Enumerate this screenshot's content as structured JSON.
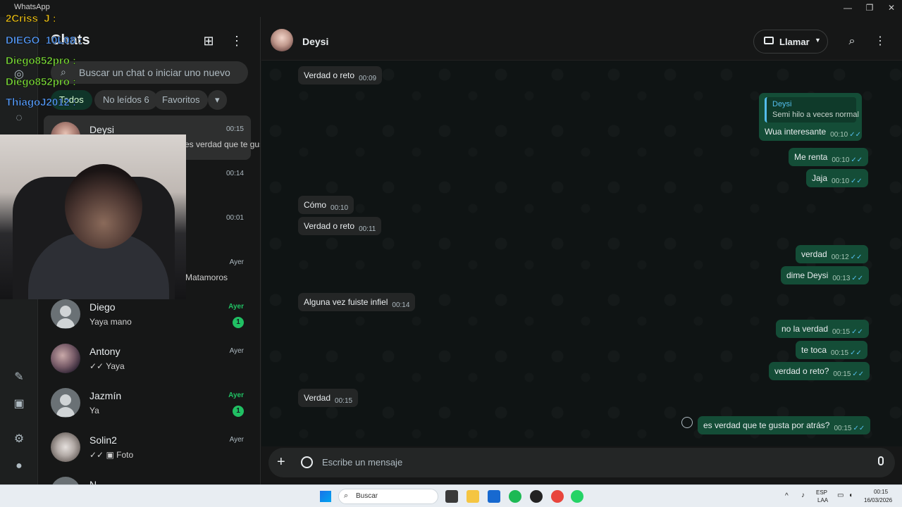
{
  "window": {
    "app_label": "WhatsApp",
    "controls": [
      "—",
      "❐",
      "✕"
    ]
  },
  "sidebar": {
    "title": "Chats",
    "search_placeholder": "Buscar un chat o iniciar uno nuevo",
    "filters": [
      {
        "label": "Todos",
        "active": true
      },
      {
        "label": "No leídos 6",
        "active": false
      },
      {
        "label": "Favoritos",
        "active": false
      }
    ],
    "chats": [
      {
        "name": "Deysi",
        "preview": "es verdad que te gusta por atrás?",
        "time": "00:15",
        "selected": true
      },
      {
        "name": "",
        "preview": "",
        "time": "00:14"
      },
      {
        "name": "",
        "preview": "",
        "time": "00:01"
      },
      {
        "name": "",
        "preview": "Matamoros",
        "time": "Ayer"
      },
      {
        "name": "Diego",
        "preview": "Yaya mano",
        "time": "Ayer",
        "unread": "1"
      },
      {
        "name": "Antony",
        "preview": "✓✓ Yaya",
        "time": "Ayer"
      },
      {
        "name": "Jazmín",
        "preview": "Ya",
        "time": "Ayer",
        "unread": "1"
      },
      {
        "name": "Solin2",
        "preview": "✓✓ ▣ Foto",
        "time": "Ayer"
      },
      {
        "name": "N",
        "preview": "",
        "time": ""
      }
    ]
  },
  "conversation": {
    "contact_name": "Deysi",
    "call_label": "Llamar",
    "composer_placeholder": "Escribe un mensaje",
    "messages": [
      {
        "dir": "in",
        "text": "Verdad o reto",
        "time": "00:09"
      },
      {
        "dir": "out",
        "quote_name": "Deysi",
        "quote_text": "Semi hilo a veces normal",
        "text": "Wua interesante",
        "time": "00:10"
      },
      {
        "dir": "out",
        "text": "Me renta",
        "time": "00:10"
      },
      {
        "dir": "out",
        "text": "Jaja",
        "time": "00:10"
      },
      {
        "dir": "in",
        "text": "Cómo",
        "time": "00:10"
      },
      {
        "dir": "in",
        "text": "Verdad o reto",
        "time": "00:11"
      },
      {
        "dir": "out",
        "text": "verdad",
        "time": "00:12"
      },
      {
        "dir": "out",
        "text": "dime Deysi",
        "time": "00:13"
      },
      {
        "dir": "in",
        "text": "Alguna vez fuiste infiel",
        "time": "00:14"
      },
      {
        "dir": "out",
        "text": "no la verdad",
        "time": "00:15"
      },
      {
        "dir": "out",
        "text": "te toca",
        "time": "00:15"
      },
      {
        "dir": "out",
        "text": "verdad o reto?",
        "time": "00:15"
      },
      {
        "dir": "in",
        "text": "Verdad",
        "time": "00:15"
      },
      {
        "dir": "out",
        "text": "es verdad que te gusta por atrás?",
        "time": "00:15"
      }
    ]
  },
  "stream_chat_overlay": [
    {
      "user": "2Criss_J :",
      "color": "#f0c419"
    },
    {
      "user": "DIEGO_10L08 :",
      "color": "#5aa0ff"
    },
    {
      "user": "Diego852pro :",
      "color": "#7ddc3a"
    },
    {
      "user": "Diego852pro :",
      "color": "#7ddc3a"
    },
    {
      "user": "ThiagoJ2012 :",
      "color": "#5aa0ff"
    }
  ],
  "taskbar": {
    "search_placeholder": "Buscar",
    "lang": "ESP",
    "lang2": "LAA",
    "clock_time": "00:15",
    "clock_date": "16/03/2026"
  },
  "colors": {
    "accent": "#21c063",
    "outgoing_bubble": "#144d37",
    "incoming_bubble": "#242626",
    "read_tick": "#53bdeb"
  }
}
